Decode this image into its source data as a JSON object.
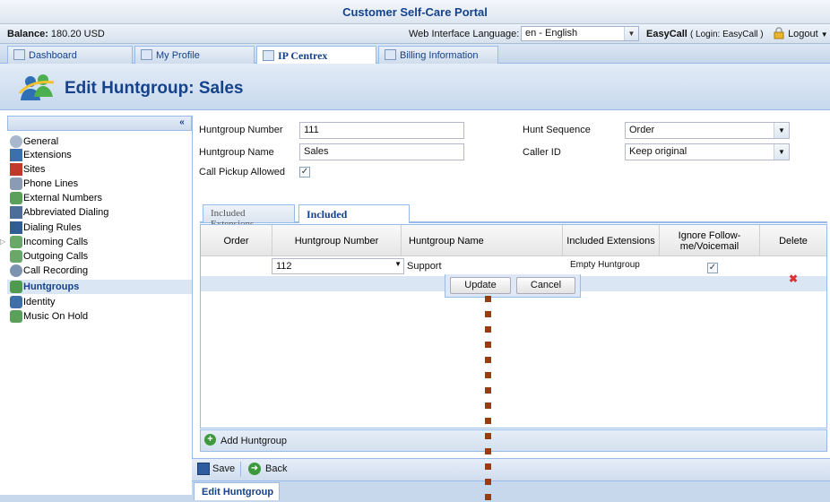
{
  "portal": {
    "title": "Customer Self-Care Portal"
  },
  "infobar": {
    "balance_label": "Balance:",
    "balance_value": "180.20 USD",
    "language_label": "Web Interface Language:",
    "language_value": "en - English",
    "user_name": "EasyCall",
    "user_login": "( Login: EasyCall )",
    "logout_label": "Logout"
  },
  "tabs": [
    {
      "label": "Dashboard"
    },
    {
      "label": "My Profile"
    },
    {
      "label": "IP Centrex"
    },
    {
      "label": "Billing Information"
    }
  ],
  "header": {
    "title": "Edit Huntgroup: Sales"
  },
  "sidebar": {
    "collapse_glyph": "«",
    "items": [
      {
        "label": "General"
      },
      {
        "label": "Extensions"
      },
      {
        "label": "Sites"
      },
      {
        "label": "Phone Lines"
      },
      {
        "label": "External Numbers"
      },
      {
        "label": "Abbreviated Dialing"
      },
      {
        "label": "Dialing Rules"
      },
      {
        "label": "Incoming Calls"
      },
      {
        "label": "Outgoing Calls"
      },
      {
        "label": "Call Recording"
      },
      {
        "label": "Huntgroups"
      },
      {
        "label": "Identity"
      },
      {
        "label": "Music On Hold"
      }
    ]
  },
  "form": {
    "number_label": "Huntgroup Number",
    "number_value": "111",
    "name_label": "Huntgroup Name",
    "name_value": "Sales",
    "pickup_label": "Call Pickup Allowed",
    "hunt_seq_label": "Hunt Sequence",
    "hunt_seq_value": "Order",
    "caller_id_label": "Caller ID",
    "caller_id_value": "Keep original"
  },
  "inner_tabs": [
    {
      "label": "Included Extensions"
    },
    {
      "label": "Included Huntgroups"
    }
  ],
  "grid": {
    "columns": [
      "Order",
      "Huntgroup Number",
      "Huntgroup Name",
      "Included Extensions",
      "Ignore Follow-me/Voicemail",
      "Delete"
    ],
    "edit_row": {
      "number": "112",
      "name": "Support",
      "included": "Empty Huntgroup"
    },
    "update_label": "Update",
    "cancel_label": "Cancel",
    "add_label": "Add Huntgroup"
  },
  "footer": {
    "save_label": "Save",
    "back_label": "Back",
    "bottom_tab": "Edit Huntgroup"
  },
  "colors": {
    "accent": "#15428b",
    "panel": "#99bbe8",
    "marker": "#9b3b10"
  }
}
